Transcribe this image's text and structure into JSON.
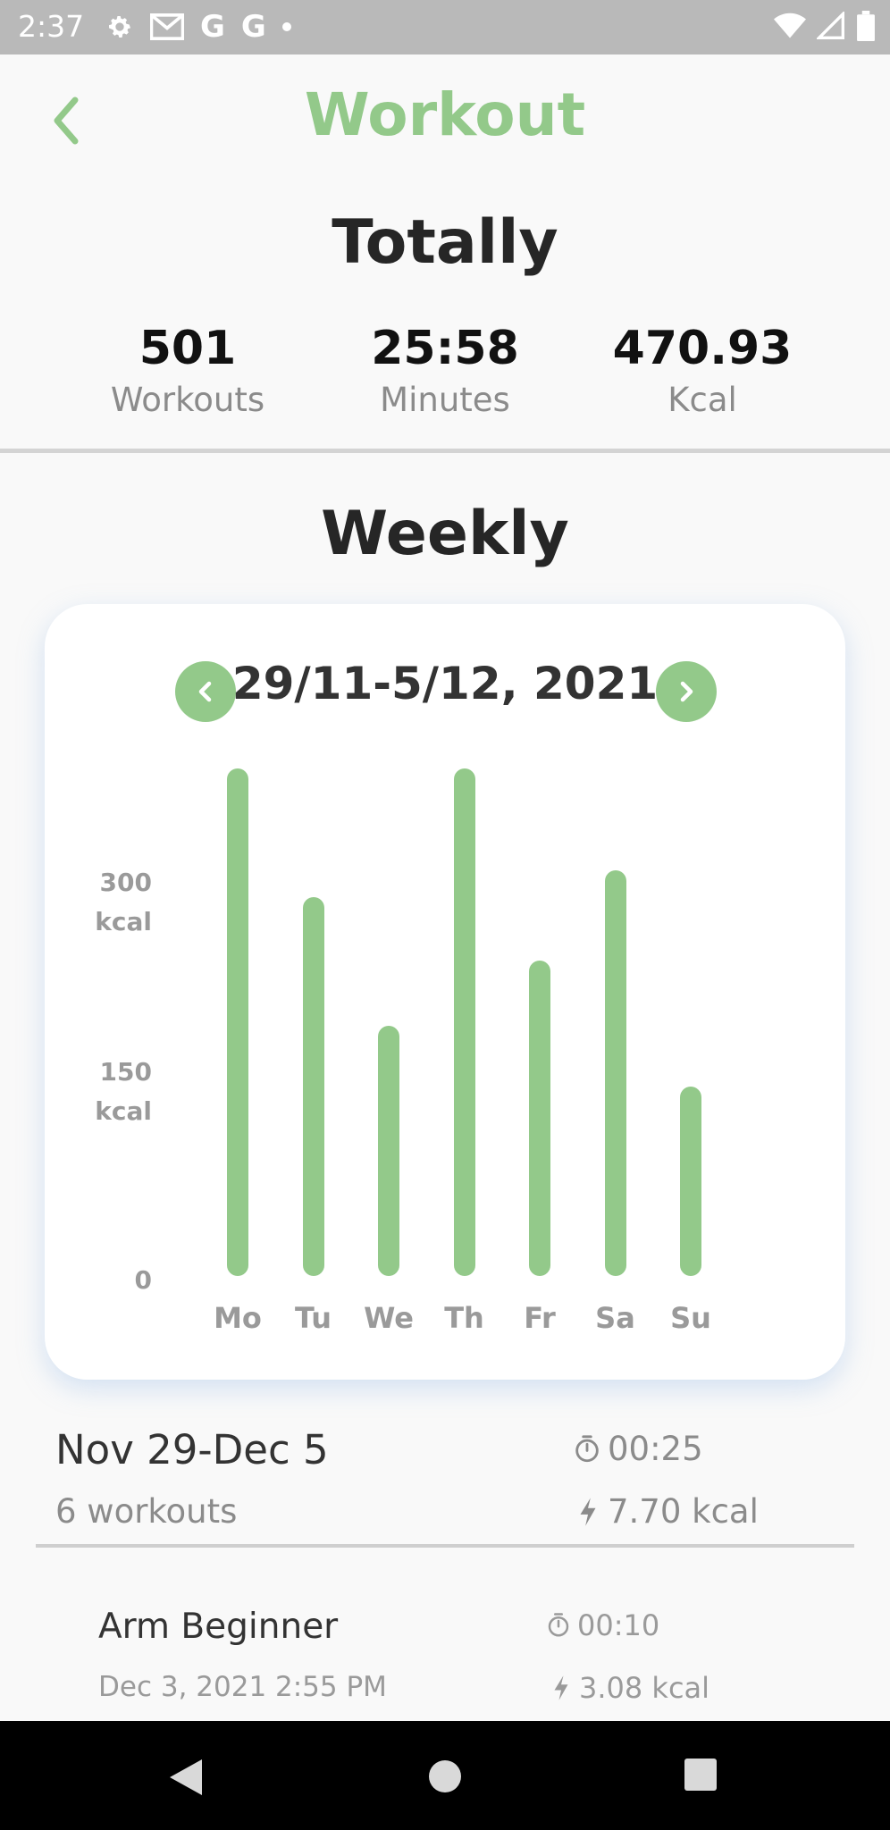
{
  "status_bar": {
    "time": "2:37",
    "icons": [
      "gear-icon",
      "mail-icon",
      "google-icon",
      "google-icon",
      "dot-icon",
      "wifi-icon",
      "signal-icon",
      "battery-icon"
    ],
    "g1": "G",
    "g2": "G"
  },
  "header": {
    "title": "Workout",
    "back_icon": "chevron-left-icon"
  },
  "totally": {
    "heading": "Totally",
    "stats": [
      {
        "value": "501",
        "label": "Workouts"
      },
      {
        "value": "25:58",
        "label": "Minutes"
      },
      {
        "value": "470.93",
        "label": "Kcal"
      }
    ]
  },
  "weekly": {
    "heading": "Weekly",
    "range": "29/11-5/12, 2021",
    "prev_icon": "chevron-left-icon",
    "next_icon": "chevron-right-icon",
    "y_ticks": [
      {
        "line1": "300",
        "line2": "kcal"
      },
      {
        "line1": "150",
        "line2": "kcal"
      },
      {
        "line1": "0",
        "line2": ""
      }
    ]
  },
  "chart_data": {
    "type": "bar",
    "categories": [
      "Mo",
      "Tu",
      "We",
      "Th",
      "Fr",
      "Sa",
      "Su"
    ],
    "values": [
      375,
      280,
      185,
      375,
      233,
      300,
      140
    ],
    "ylim": [
      0,
      375
    ],
    "yticks": [
      0,
      150,
      300
    ],
    "ylabel": "",
    "xlabel": "",
    "title": "",
    "color": "#93c98a",
    "grid": false
  },
  "summary": {
    "range": "Nov 29-Dec 5",
    "count": "6 workouts",
    "time": "00:25",
    "kcal": "7.70 kcal"
  },
  "items": [
    {
      "name": "Arm Beginner",
      "date": "Dec 3, 2021 2:55 PM",
      "time": "00:10",
      "kcal": "3.08 kcal"
    }
  ],
  "colors": {
    "accent": "#93c98a",
    "text_dark": "#262626",
    "text_muted": "#8b8b8b"
  }
}
